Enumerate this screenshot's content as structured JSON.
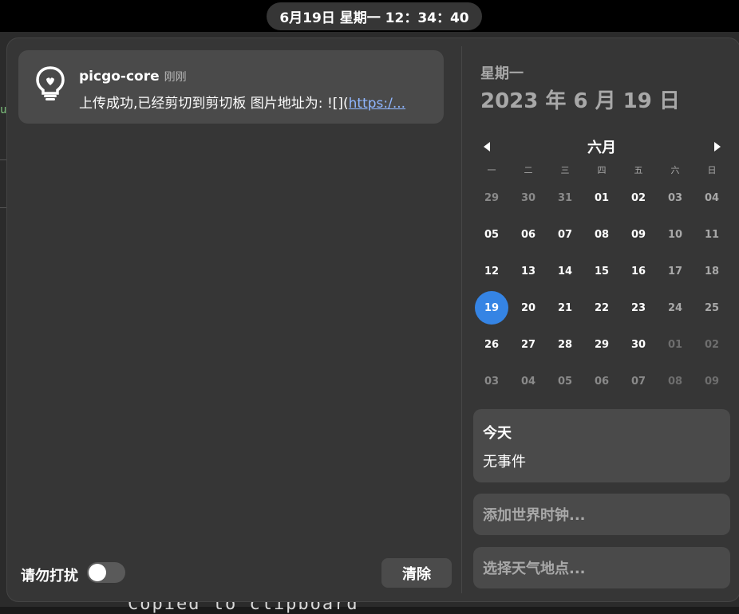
{
  "topbar": {
    "clock": "6月19日 星期一  12：34：40"
  },
  "notification": {
    "app": "picgo-core",
    "time": "刚刚",
    "body_prefix": "上传成功,已经剪切到剪切板 图片地址为: ![](",
    "body_link": "https:/...",
    "icon": "lightbulb-icon"
  },
  "footer": {
    "dnd_label": "请勿打扰",
    "dnd_on": false,
    "clear_label": "清除"
  },
  "calendar": {
    "weekday": "星期一",
    "date": "2023 年 6 月 19 日",
    "month": "六月",
    "prev_icon": "chevron-left-icon",
    "next_icon": "chevron-right-icon",
    "weekday_headers": [
      "一",
      "二",
      "三",
      "四",
      "五",
      "六",
      "日"
    ],
    "weeks": [
      [
        "29",
        "30",
        "31",
        "01",
        "02",
        "03",
        "04"
      ],
      [
        "05",
        "06",
        "07",
        "08",
        "09",
        "10",
        "11"
      ],
      [
        "12",
        "13",
        "14",
        "15",
        "16",
        "17",
        "18"
      ],
      [
        "19",
        "20",
        "21",
        "22",
        "23",
        "24",
        "25"
      ],
      [
        "26",
        "27",
        "28",
        "29",
        "30",
        "01",
        "02"
      ],
      [
        "03",
        "04",
        "05",
        "06",
        "07",
        "08",
        "09"
      ]
    ],
    "today": "19",
    "accent": "#3584e4"
  },
  "events": {
    "title": "今天",
    "empty": "无事件"
  },
  "world_clock_label": "添加世界时钟...",
  "weather_label": "选择天气地点...",
  "background": {
    "terminal_text": "Copied to clipboard"
  }
}
